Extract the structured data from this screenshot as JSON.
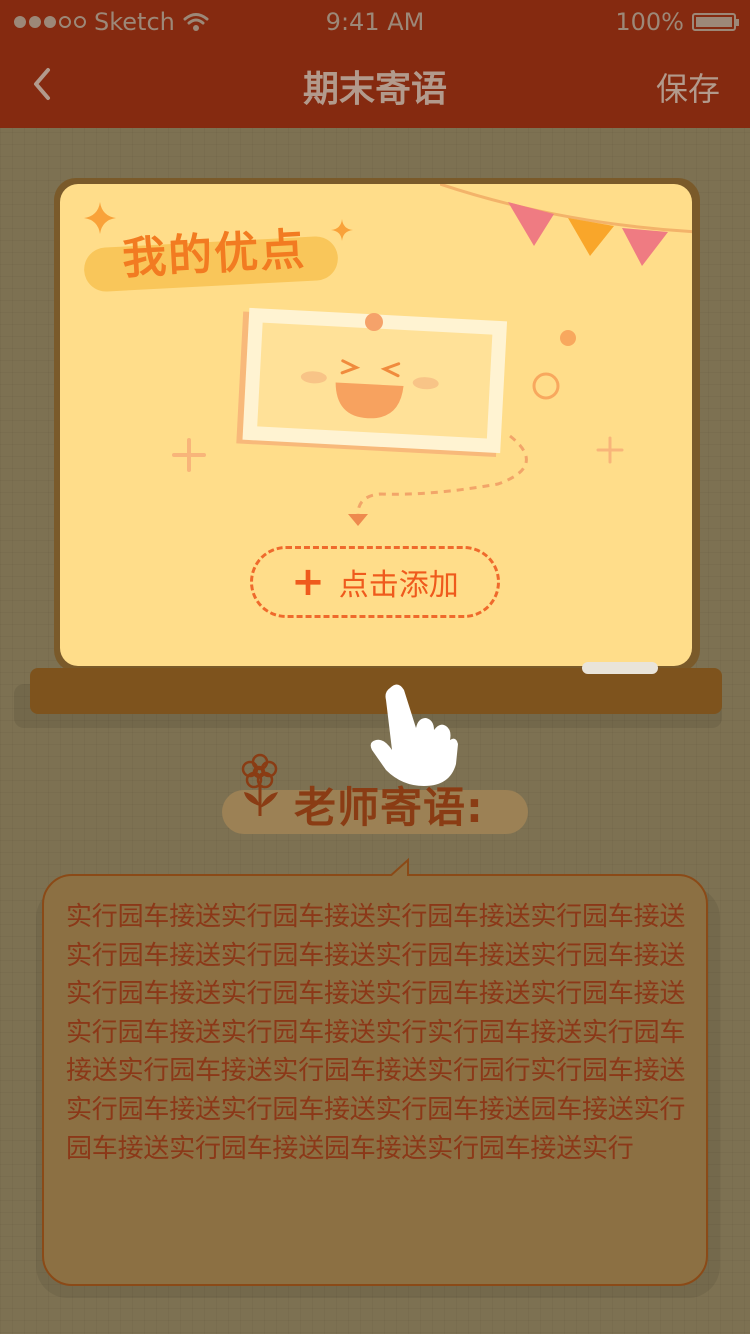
{
  "status_bar": {
    "carrier": "Sketch",
    "time": "9:41 AM",
    "battery": "100%"
  },
  "nav": {
    "title": "期末寄语",
    "save_label": "保存"
  },
  "board": {
    "title": "我的优点",
    "add_label": "点击添加"
  },
  "teacher": {
    "heading": "老师寄语:",
    "message": "实行园车接送实行园车接送实行园车接送实行园车接送实行园车接送实行园车接送实行园车接送实行园车接送实行园车接送实行园车接送实行园车接送实行园车接送实行园车接送实行园车接送实行实行园车接送实行园车接送实行园车接送实行园车接送实行园行实行园车接送实行园车接送实行园车接送实行园车接送园车接送实行园车接送实行园车接送园车接送实行园车接送实行"
  },
  "colors": {
    "nav_bg": "#852a10",
    "board_bg": "#ffdd8a",
    "accent_orange": "#ef5a1c",
    "page_bg": "#7d7152"
  }
}
